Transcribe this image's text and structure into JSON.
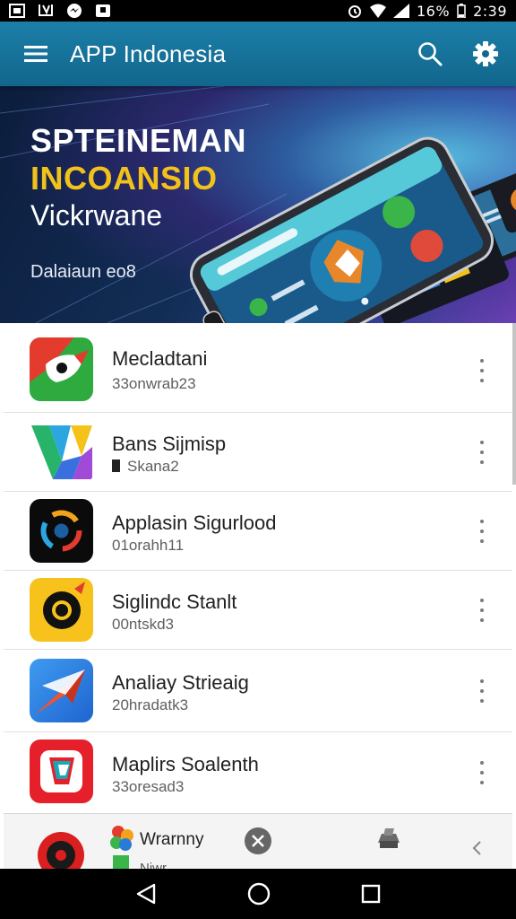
{
  "status": {
    "battery": "16%",
    "time": "2:39"
  },
  "app_bar": {
    "title": "APP Indonesia",
    "icons": [
      "menu-icon",
      "search-icon",
      "settings-icon"
    ]
  },
  "banner": {
    "line1": "SPTEINEMAN",
    "line2": "INCOANSIO",
    "line3": "Vickrwane",
    "subtitle": "Dalaiaun eo8"
  },
  "apps": [
    {
      "title": "Mecladtani",
      "subtitle": "33onwrab23",
      "icon": "red-bird-icon"
    },
    {
      "title": "Bans  Sijmisp",
      "subtitle": "Skana2",
      "icon": "colorful-w-icon"
    },
    {
      "title": "Applasin Sigurlood",
      "subtitle": "01orahh11",
      "icon": "camera-lens-icon"
    },
    {
      "title": "Siglindc Stanlt",
      "subtitle": "00ntskd3",
      "icon": "yellow-eye-icon"
    },
    {
      "title": "Analiay Strieaig",
      "subtitle": "20hradatk3",
      "icon": "paper-plane-icon"
    },
    {
      "title": "Maplirs Soalenth",
      "subtitle": "33oresad3",
      "icon": "red-shield-icon"
    }
  ],
  "peek_row": {
    "title": "Wrarnny",
    "subtitle": "Niwr"
  },
  "colors": {
    "app_bar": "#11668c",
    "banner_yellow": "#f1c21b"
  }
}
